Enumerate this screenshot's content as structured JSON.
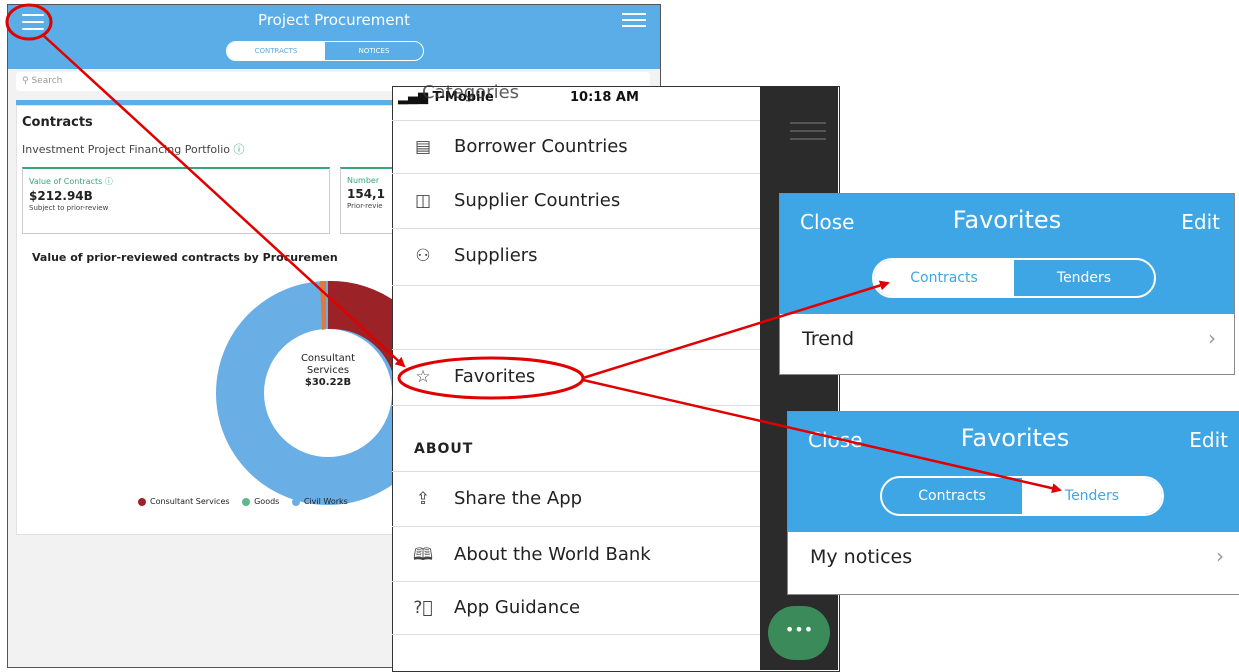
{
  "app": {
    "title": "Project Procurement",
    "tabs": [
      "CONTRACTS",
      "NOTICES"
    ],
    "search_placeholder": "Search",
    "contracts_heading": "Contracts",
    "portfolio_label": "Investment Project Financing Portfolio",
    "info_icon": "ⓘ",
    "stat_value_label": "Value of Contracts",
    "stat_value": "$212.94B",
    "stat_value_sub": "Subject to prior-review",
    "stat_number_label": "Number",
    "stat_number": "154,1",
    "stat_number_sub": "Prior-revie",
    "chart_label": "Value of prior-reviewed contracts by Procuremen",
    "donut_center_line1": "Consultant",
    "donut_center_line2": "Services",
    "donut_center_value": "$30.22B",
    "legend": [
      {
        "label": "Consultant Services",
        "color": "#9b2226"
      },
      {
        "label": "Goods",
        "color": "#5cb88a"
      },
      {
        "label": "Civil Works",
        "color": "#6aaee6"
      }
    ]
  },
  "menu": {
    "carrier": "T-Mobile",
    "overlapped_text": "Categories",
    "time": "10:18 AM",
    "items": [
      {
        "label": "Borrower Countries",
        "icon": "borrower-countries-icon"
      },
      {
        "label": "Supplier Countries",
        "icon": "supplier-countries-icon"
      },
      {
        "label": "Suppliers",
        "icon": "suppliers-icon"
      },
      {
        "label": "Favorites",
        "icon": "star-icon"
      }
    ],
    "about_heading": "ABOUT",
    "about_items": [
      {
        "label": "Share the App",
        "icon": "share-icon"
      },
      {
        "label": "About the World Bank",
        "icon": "book-icon"
      },
      {
        "label": "App Guidance",
        "icon": "help-icon"
      }
    ]
  },
  "favorites_contracts": {
    "close": "Close",
    "title": "Favorites",
    "edit": "Edit",
    "tabs": [
      "Contracts",
      "Tenders"
    ],
    "active_tab": "Contracts",
    "row": "Trend"
  },
  "favorites_tenders": {
    "close": "Close",
    "title": "Favorites",
    "edit": "Edit",
    "tabs": [
      "Contracts",
      "Tenders"
    ],
    "active_tab": "Tenders",
    "row": "My notices"
  },
  "colors": {
    "header_blue": "#5aade6",
    "fav_blue": "#3fa6e5",
    "annotation_red": "#e00000",
    "accent_green": "#36a57a"
  }
}
